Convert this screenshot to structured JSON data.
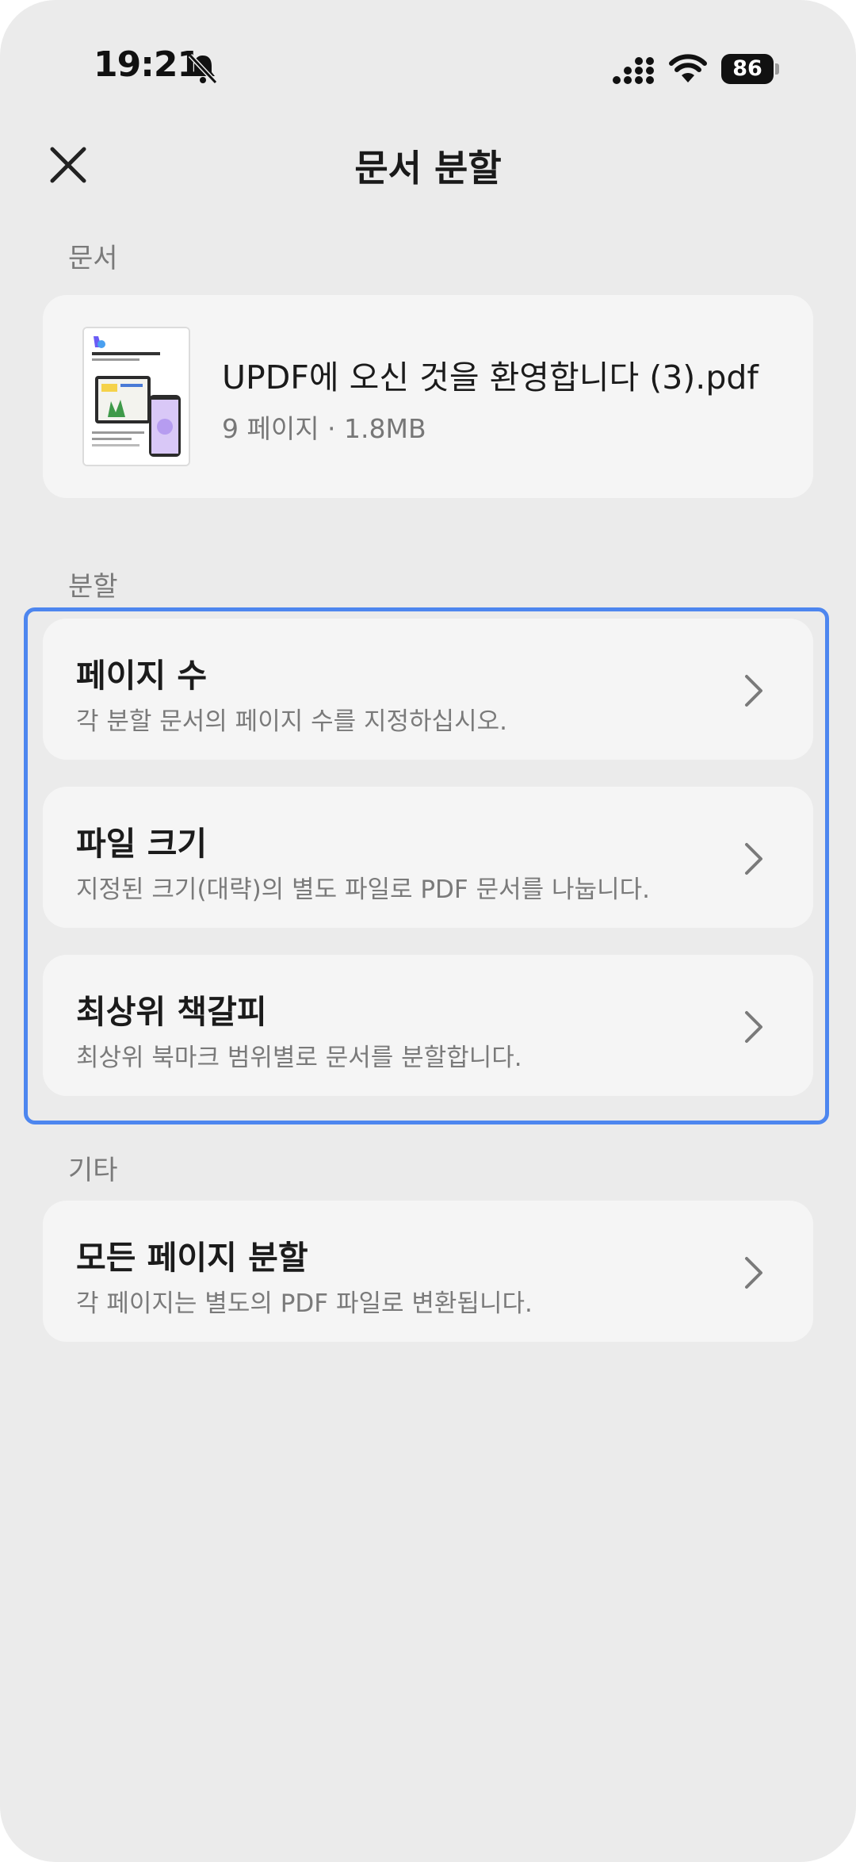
{
  "status_bar": {
    "time": "19:21",
    "battery": "86",
    "icons": [
      "bell-muted-icon",
      "signal-icon",
      "wifi-icon",
      "battery-icon"
    ]
  },
  "header": {
    "title": "문서 분할",
    "close_icon": "close-icon"
  },
  "document_section": {
    "label": "문서",
    "file_name": "UPDF에 오신 것을 환영합니다 (3).pdf",
    "file_meta": "9 페이지 · 1.8MB"
  },
  "split_section": {
    "label": "분할",
    "options": [
      {
        "title": "페이지 수",
        "description": "각 분할 문서의 페이지 수를 지정하십시오."
      },
      {
        "title": "파일 크기",
        "description": "지정된 크기(대략)의 별도 파일로 PDF 문서를 나눕니다."
      },
      {
        "title": "최상위 책갈피",
        "description": "최상위 북마크 범위별로 문서를 분할합니다."
      }
    ]
  },
  "other_section": {
    "label": "기타",
    "options": [
      {
        "title": "모든 페이지 분할",
        "description": "각 페이지는 별도의 PDF 파일로 변환됩니다."
      }
    ]
  },
  "colors": {
    "background": "#ebebeb",
    "card": "#f5f5f5",
    "highlight": "#4d86ef"
  }
}
